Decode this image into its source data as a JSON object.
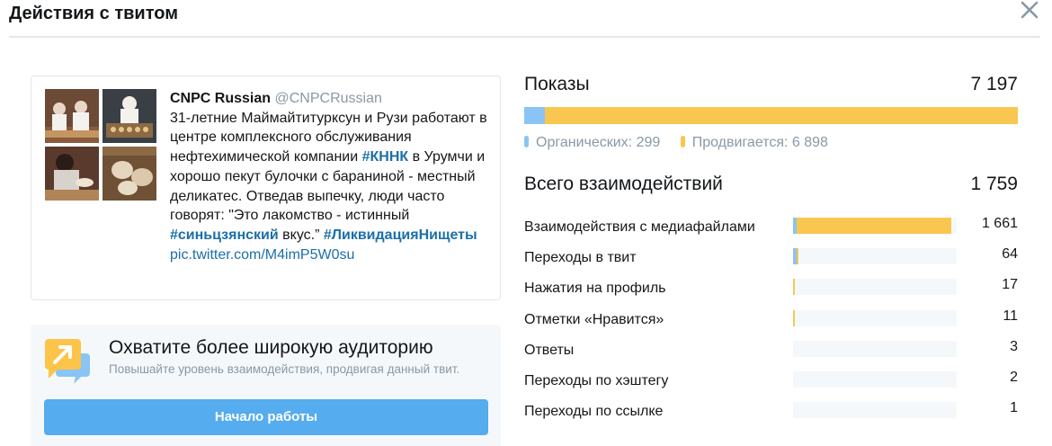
{
  "modal": {
    "title": "Действия с твитом",
    "close_icon": "close-icon"
  },
  "tweet": {
    "author_name": "CNPC Russian",
    "author_handle": "@CNPCRussian",
    "text_1": "31-летние Маймайтитурксун и Рузи работают в центре комплексного обслуживания нефтехимической компании ",
    "hashtag_1": "#КННК",
    "text_2": " в Урумчи и хорошо пекут булочки с бараниной - местный деликатес. Отведав выпечку, люди часто говорят: \"Это лакомство - истинный ",
    "hashtag_2": "#синьцзянский",
    "text_3": " вкус.” ",
    "hashtag_3": "#ЛиквидацияНищеты",
    "link": "pic.twitter.com/M4imP5W0su",
    "media_icons": [
      "bakers-photo",
      "bread-tray-photo",
      "kneading-photo",
      "dumplings-photo"
    ]
  },
  "promo": {
    "title": "Охватите более широкую аудиторию",
    "subtitle": "Повышайте уровень взаимодействия, продвигая данный твит.",
    "button_label": "Начало работы",
    "icon": "promote-icon",
    "colors": {
      "background": "#f5f8fa",
      "button": "#55acee"
    }
  },
  "impressions": {
    "label": "Показы",
    "value": "7 197",
    "organic_label": "Органических: 299",
    "promoted_label": "Продвигается: 6 898",
    "organic_share": 0.0415,
    "colors": {
      "organic": "#89c4f4",
      "promoted": "#f9c74f"
    }
  },
  "engagements": {
    "label": "Всего взаимодействий",
    "value": "1 759",
    "rows": [
      {
        "label": "Взаимодействия с медиафайлами",
        "value": "1 661",
        "organic_fraction": 0.02,
        "promoted_fraction": 0.945
      },
      {
        "label": "Переходы в твит",
        "value": "64",
        "organic_fraction": 0.02,
        "promoted_fraction": 0.01
      },
      {
        "label": "Нажатия на профиль",
        "value": "17",
        "organic_fraction": 0.0,
        "promoted_fraction": 0.01
      },
      {
        "label": "Отметки «Нравится»",
        "value": "11",
        "organic_fraction": 0.0,
        "promoted_fraction": 0.01
      },
      {
        "label": "Ответы",
        "value": "3",
        "organic_fraction": 0.0,
        "promoted_fraction": 0.0
      },
      {
        "label": "Переходы по хэштегу",
        "value": "2",
        "organic_fraction": 0.0,
        "promoted_fraction": 0.0
      },
      {
        "label": "Переходы по ссылке",
        "value": "1",
        "organic_fraction": 0.0,
        "promoted_fraction": 0.0
      }
    ]
  }
}
